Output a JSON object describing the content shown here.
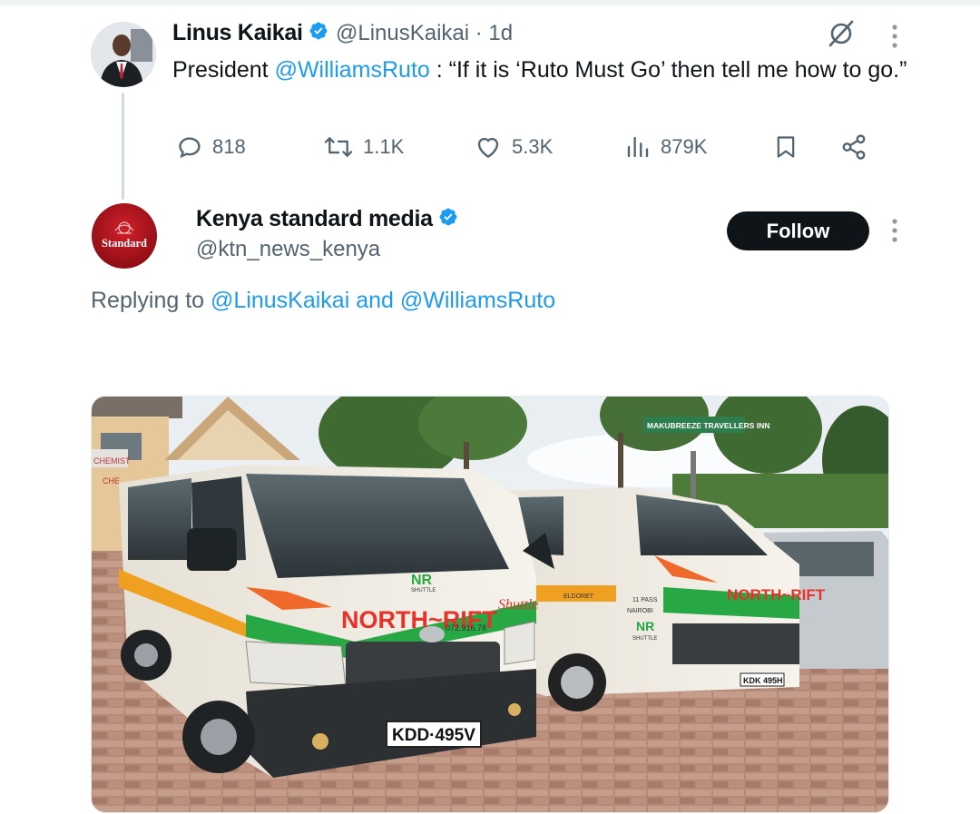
{
  "tweet1": {
    "author_name": "Linus Kaikai",
    "handle_time": "@LinusKaikai · 1d",
    "text_prefix": "President ",
    "mention": "@WilliamsRuto",
    "text_body": " : “If it is ‘Ruto Must Go’ then tell me how to go.”",
    "stats": {
      "replies": "818",
      "reposts": "1.1K",
      "likes": "5.3K",
      "views": "879K"
    }
  },
  "tweet2": {
    "author_name": "Kenya standard media",
    "handle": "@ktn_news_kenya",
    "avatar_text": "Standard",
    "follow_label": "Follow",
    "replying_prefix": "Replying to ",
    "replying_to_1": "@LinusKaikai",
    "replying_and": " and ",
    "replying_to_2": "@WilliamsRuto"
  },
  "photo": {
    "van_brand": "NORTH~RIFT",
    "van_brand_script": "Shuttle",
    "van_phone": "072.916.78",
    "plate_front": "KDD·495V",
    "plate_back": "KDK 495H",
    "sign_text": "MAKUBREEZE TRAVELLERS INN",
    "door_text_1": "ELDORET",
    "door_text_2": "NAIROBI",
    "door_text_3": "11 PASS",
    "building_sign_1": "CHEMIST",
    "building_sign_2": "CHE",
    "logo_text": "NR",
    "logo_sub": "SHUTTLE"
  },
  "colors": {
    "link": "#1d9bf0",
    "muted": "#536471",
    "text": "#0f1419",
    "verified": "#1d9bf0",
    "follow_bg": "#0f1419"
  },
  "icons": [
    "verified-badge-icon",
    "grok-icon",
    "more-icon",
    "reply-icon",
    "repost-icon",
    "like-icon",
    "views-icon",
    "bookmark-icon",
    "share-icon"
  ]
}
